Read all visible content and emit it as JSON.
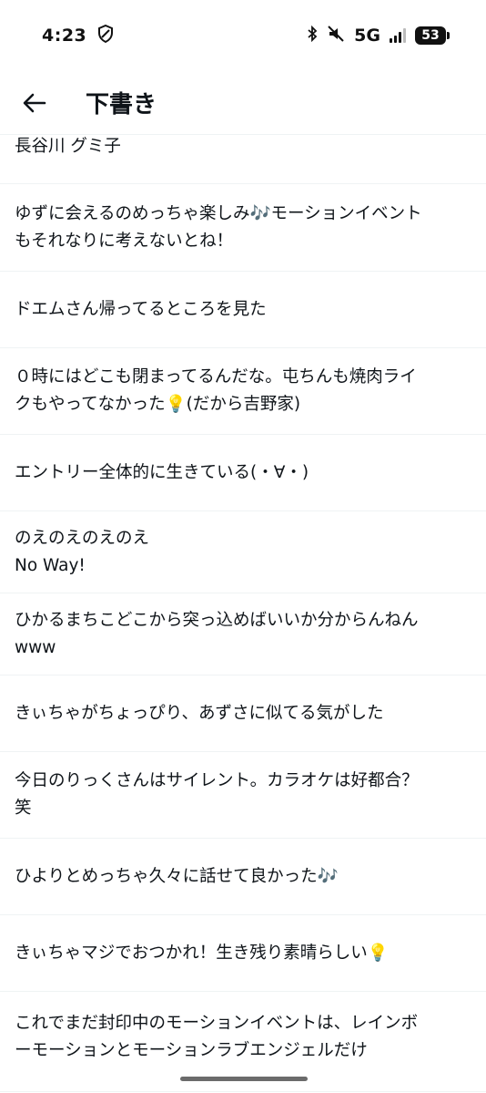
{
  "status_bar": {
    "time": "4:23",
    "network": "5G",
    "battery": "53"
  },
  "header": {
    "title": "下書き"
  },
  "drafts": [
    {
      "text": "長谷川 グミ子"
    },
    {
      "text": "ゆずに会えるのめっちゃ楽しみ🎶モーションイベント\nもそれなりに考えないとね！"
    },
    {
      "text": "ドエムさん帰ってるところを見た"
    },
    {
      "text": "０時にはどこも閉まってるんだな。屯ちんも焼肉ライ\nクもやってなかった💡(だから吉野家)"
    },
    {
      "text": "エントリー全体的に生きている(・∀・)"
    },
    {
      "text": "のえのえのえのえ\nNo Way!"
    },
    {
      "text": "ひかるまちこどこから突っ込めばいいか分からんねん\nwww"
    },
    {
      "text": "きぃちゃがちょっぴり、あずさに似てる気がした"
    },
    {
      "text": "今日のりっくさんはサイレント。カラオケは好都合？\n笑"
    },
    {
      "text": "ひよりとめっちゃ久々に話せて良かった🎶"
    },
    {
      "text": "きぃちゃマジでおつかれ！生き残り素晴らしい💡"
    },
    {
      "text": "これでまだ封印中のモーションイベントは、レインボ\nーモーションとモーションラブエンジェルだけ"
    }
  ]
}
